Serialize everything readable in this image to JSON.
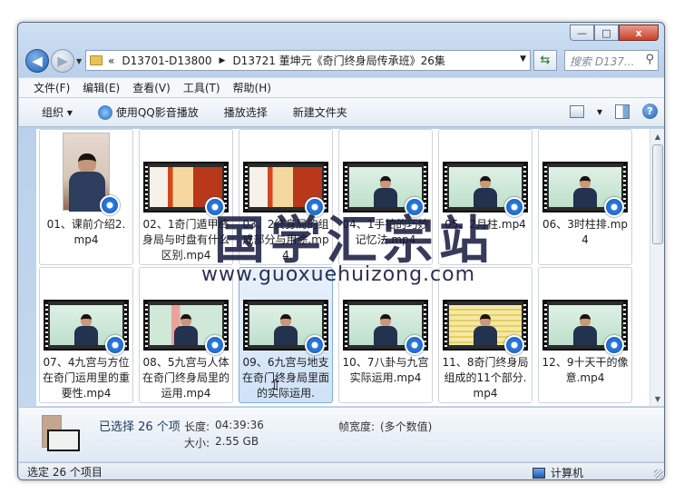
{
  "window": {
    "controls": {
      "minimize": "—",
      "maximize": "□",
      "close": "x"
    }
  },
  "nav": {
    "back_glyph": "◀",
    "forward_glyph": "▶",
    "address_prefix": "«",
    "breadcrumb": [
      "D13701-D13800",
      "D13721 董坤元《奇门终身局传承班》26集"
    ],
    "breadcrumb_sep": "▶",
    "dropdown_glyph": "▼",
    "refresh_glyph": "⇆",
    "search_placeholder": "搜索 D137...",
    "search_glyph": "⚲"
  },
  "menu": [
    "文件(F)",
    "编辑(E)",
    "查看(V)",
    "工具(T)",
    "帮助(H)"
  ],
  "toolbar": {
    "organize": "组织 ▾",
    "qq_play": "使用QQ影音播放",
    "play_selection": "播放选择",
    "new_folder": "新建文件夹",
    "view_drop": "▾",
    "help": "?"
  },
  "files": [
    {
      "name": "01、课前介绍2.mp4",
      "thumb": "portrait"
    },
    {
      "name": "02、1奇门遁甲终身局与时盘有什么区别.mp4",
      "thumb": "orange"
    },
    {
      "name": "03、2终身局的组成部分与用途.mp4",
      "thumb": "orange"
    },
    {
      "name": "04、1手拍的巧妙记忆法.mp4",
      "thumb": "green"
    },
    {
      "name": "05、2月柱.mp4",
      "thumb": "green"
    },
    {
      "name": "06、3时柱排.mp4",
      "thumb": "green"
    },
    {
      "name": "07、4九宫与方位在奇门运用里的重要性.mp4",
      "thumb": "green"
    },
    {
      "name": "08、5九宫与人体在奇门终身局里的运用.mp4",
      "thumb": "body"
    },
    {
      "name": "09、6九宫与地支在奇门终身局里面的实际运用.",
      "thumb": "green"
    },
    {
      "name": "10、7八卦与九宫实际运用.mp4",
      "thumb": "green"
    },
    {
      "name": "11、8奇门终身局组成的11个部分.mp4",
      "thumb": "table"
    },
    {
      "name": "12、9十天干的像意.mp4",
      "thumb": "green"
    }
  ],
  "details": {
    "selected": "已选择 26 个项",
    "length_label": "长度:",
    "length_value": "04:39:36",
    "size_label": "大小:",
    "size_value": "2.55 GB",
    "frame_label": "帧宽度:",
    "frame_value": "(多个数值)"
  },
  "status": {
    "selected_text": "选定 26 个项目",
    "computer": "计算机"
  },
  "watermark": {
    "cn": "国学汇宗站",
    "en": "www.guoxuehuizong.com"
  },
  "colors": {
    "accent": "#2a7be0",
    "selection": "#cfe2f8",
    "frame": "#b9d0ea"
  }
}
